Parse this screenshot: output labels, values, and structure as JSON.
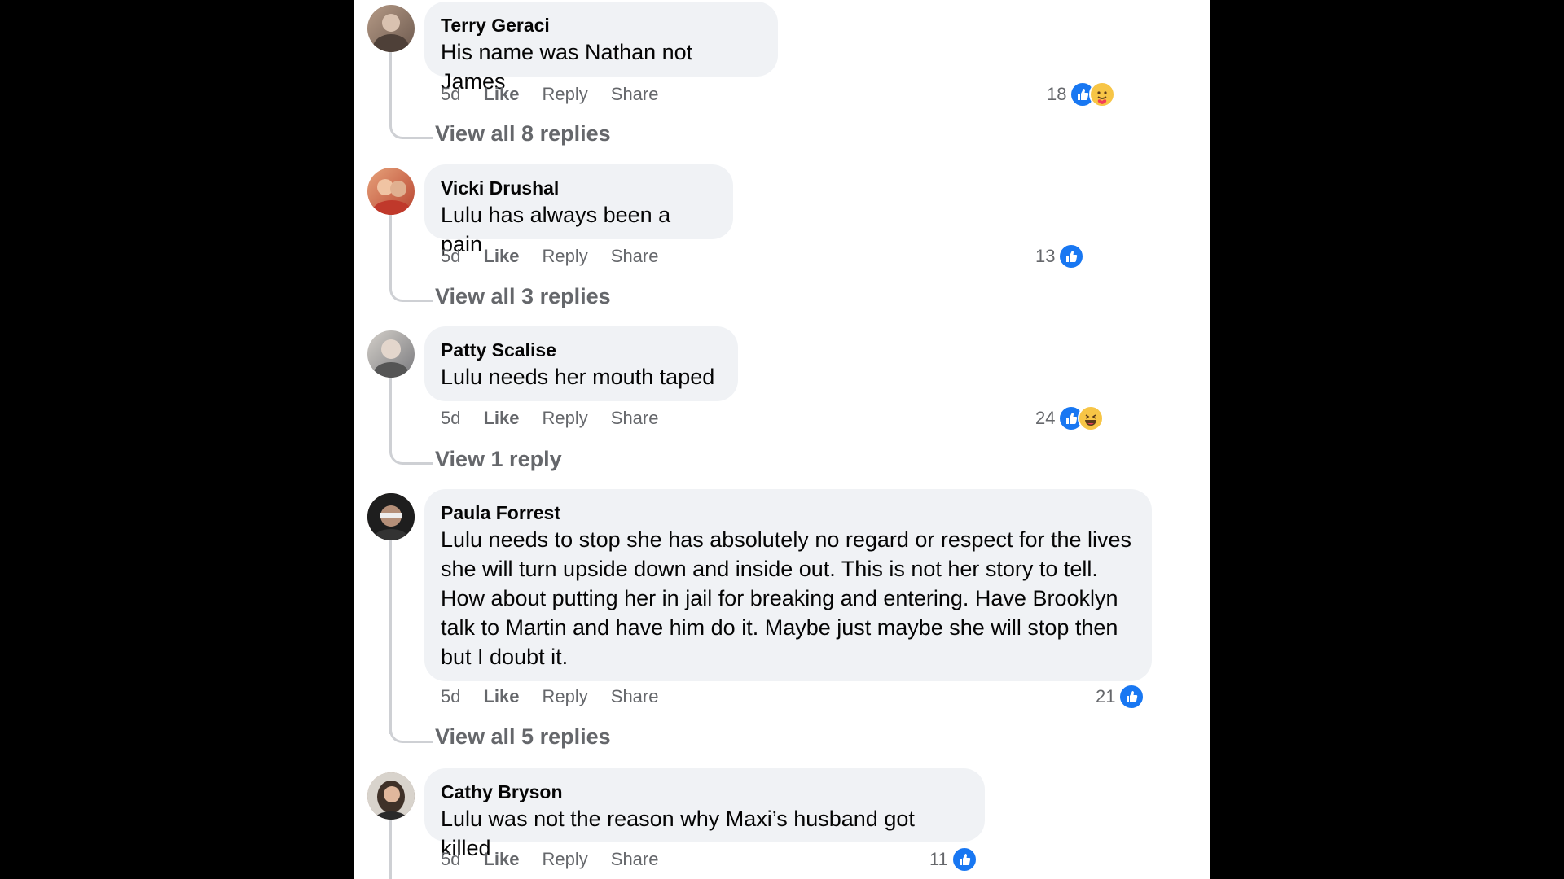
{
  "comments": [
    {
      "author": "Terry Geraci",
      "text": "His name was Nathan not James",
      "time": "5d",
      "like": "Like",
      "reply": "Reply",
      "share": "Share",
      "reaction_count": "18",
      "reactions": [
        "like",
        "care"
      ],
      "view_replies": "View all 8 replies",
      "avatar_colors": [
        "#6d5a4f",
        "#b59a86"
      ]
    },
    {
      "author": "Vicki Drushal",
      "text": "Lulu has always been a pain",
      "time": "5d",
      "like": "Like",
      "reply": "Reply",
      "share": "Share",
      "reaction_count": "13",
      "reactions": [
        "like"
      ],
      "view_replies": "View all 3 replies",
      "avatar_colors": [
        "#b8432f",
        "#e7a37b"
      ]
    },
    {
      "author": "Patty Scalise",
      "text": "Lulu needs her mouth taped",
      "time": "5d",
      "like": "Like",
      "reply": "Reply",
      "share": "Share",
      "reaction_count": "24",
      "reactions": [
        "like",
        "haha"
      ],
      "view_replies": "View 1 reply",
      "avatar_colors": [
        "#7a7a7e",
        "#d3cfc9"
      ]
    },
    {
      "author": "Paula Forrest",
      "text": "Lulu needs to stop she has absolutely no regard or respect for the lives she will turn upside down and inside out. This is not her story to tell. How about putting her in jail for breaking and entering. Have Brooklyn talk to Martin and have him do it. Maybe just maybe she will stop then but I doubt it.",
      "time": "5d",
      "like": "Like",
      "reply": "Reply",
      "share": "Share",
      "reaction_count": "21",
      "reactions": [
        "like"
      ],
      "view_replies": "View all 5 replies",
      "avatar_colors": [
        "#1e1e1e",
        "#8a7465"
      ]
    },
    {
      "author": "Cathy Bryson",
      "text": "Lulu was not the reason why Maxi’s husband got killed",
      "time": "5d",
      "like": "Like",
      "reply": "Reply",
      "share": "Share",
      "reaction_count": "11",
      "reactions": [
        "like"
      ],
      "view_replies": "",
      "avatar_colors": [
        "#3f3128",
        "#c49b82"
      ]
    }
  ],
  "colors": {
    "background": "#000000",
    "panel": "#ffffff",
    "bubble": "#f0f2f5",
    "meta_text": "#65676b",
    "like_blue": "#1877f2",
    "emoji_yellow": "#f7c546"
  },
  "icons": {
    "like": "thumbs-up-icon",
    "care": "care-emoji-icon",
    "haha": "laughing-emoji-icon"
  }
}
